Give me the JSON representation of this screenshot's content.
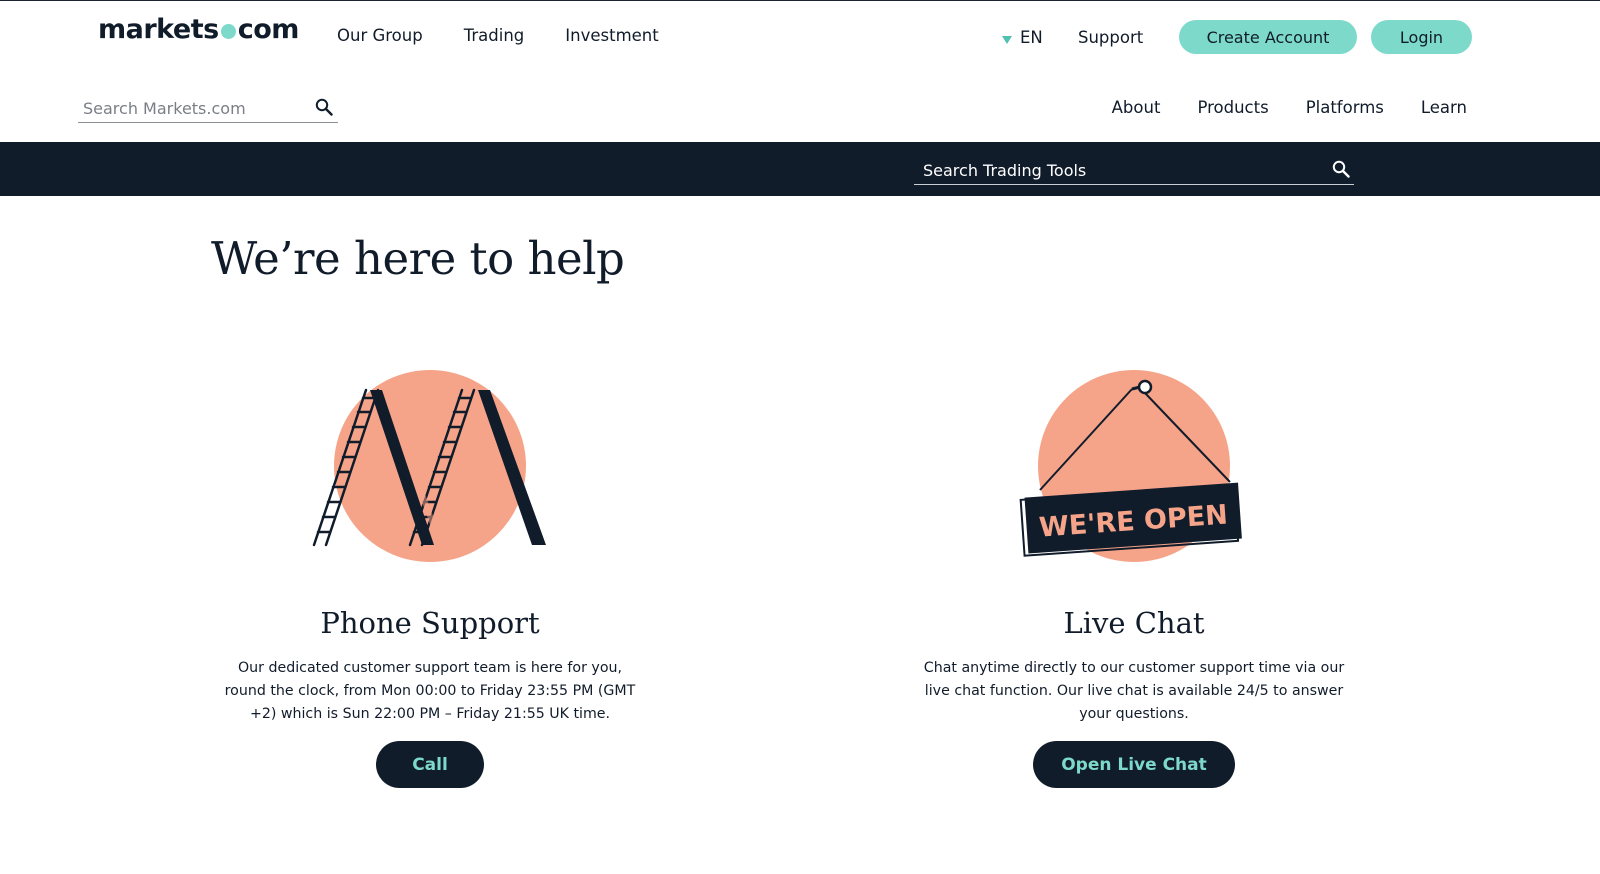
{
  "header": {
    "logo_left": "markets",
    "logo_right": "com",
    "nav": [
      "Our Group",
      "Trading",
      "Investment"
    ],
    "language": "EN",
    "support": "Support",
    "create_account": "Create Account",
    "login": "Login"
  },
  "search": {
    "placeholder": "Search Markets.com"
  },
  "subnav": [
    "About",
    "Products",
    "Platforms",
    "Learn"
  ],
  "tools": {
    "placeholder": "Search Trading Tools"
  },
  "main": {
    "title": "We’re here to help",
    "phone": {
      "heading": "Phone Support",
      "text": "Our dedicated customer support team is here for you, round the clock, from Mon 00:00 to Friday 23:55 PM (GMT +2) which is Sun 22:00 PM – Friday 21:55 UK time.",
      "button": "Call"
    },
    "chat": {
      "heading": "Live Chat",
      "text": "Chat anytime directly to our customer support time via our live chat function. Our live chat is available 24/5 to answer your questions.",
      "button": "Open Live Chat",
      "sign_text": "WE'RE OPEN"
    }
  },
  "colors": {
    "accent": "#7dd9c9",
    "navy": "#111c2b",
    "peach": "#f6a489"
  },
  "icons": [
    "search-icon",
    "chevron-down-icon",
    "ladders-illustration",
    "open-sign-illustration"
  ]
}
